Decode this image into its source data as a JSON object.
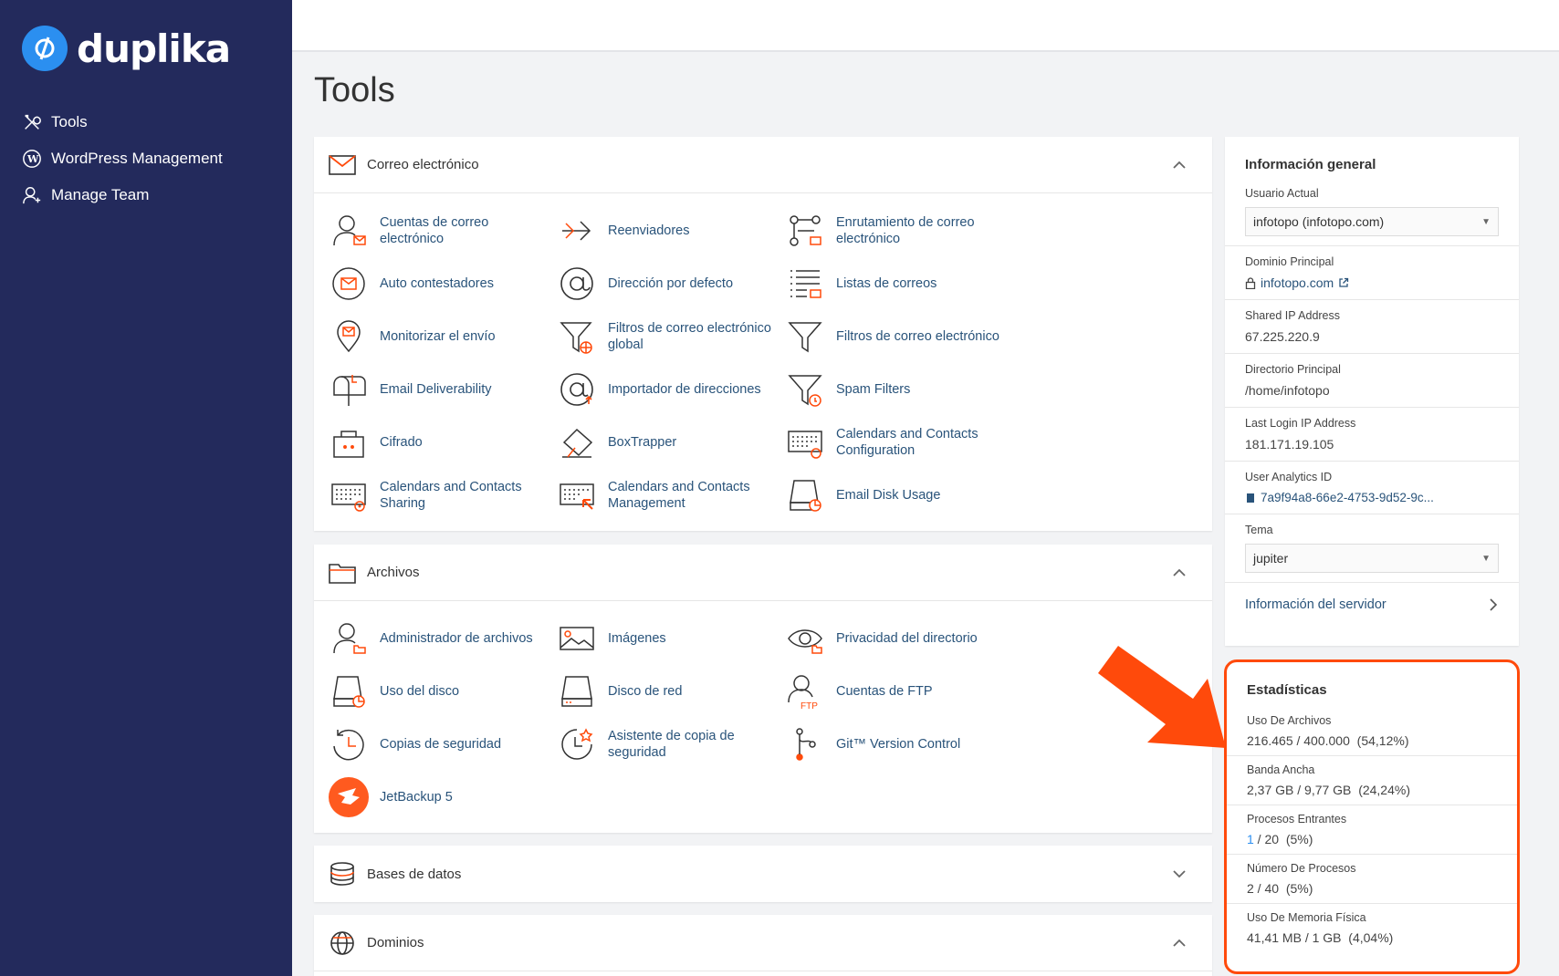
{
  "brand": {
    "name": "duplika"
  },
  "sidebar": {
    "items": [
      {
        "label": "Tools",
        "icon": "tools-icon"
      },
      {
        "label": "WordPress Management",
        "icon": "wordpress-icon"
      },
      {
        "label": "Manage Team",
        "icon": "team-icon"
      }
    ]
  },
  "page": {
    "title": "Tools"
  },
  "sections": {
    "email": {
      "title": "Correo electrónico",
      "tools": [
        [
          "Cuentas de correo",
          "electrónico"
        ],
        [
          "Reenviadores"
        ],
        [
          "Enrutamiento de correo",
          "electrónico"
        ],
        [
          "Auto contestadores"
        ],
        [
          "Dirección por defecto"
        ],
        [
          "Listas de correos"
        ],
        [
          "Monitorizar el envío"
        ],
        [
          "Filtros de correo electrónico",
          "global"
        ],
        [
          "Filtros de correo electrónico"
        ],
        [
          "Email Deliverability"
        ],
        [
          "Importador de direcciones"
        ],
        [
          "Spam Filters"
        ],
        [
          "Cifrado"
        ],
        [
          "BoxTrapper"
        ],
        [
          "Calendars and Contacts",
          "Configuration"
        ],
        [
          "Calendars and Contacts",
          "Sharing"
        ],
        [
          "Calendars and Contacts",
          "Management"
        ],
        [
          "Email Disk Usage"
        ]
      ]
    },
    "files": {
      "title": "Archivos",
      "tools": [
        [
          "Administrador de archivos"
        ],
        [
          "Imágenes"
        ],
        [
          "Privacidad del directorio"
        ],
        [
          "Uso del disco"
        ],
        [
          "Disco de red"
        ],
        [
          "Cuentas de FTP"
        ],
        [
          "Copias de seguridad"
        ],
        [
          "Asistente de copia de",
          "seguridad"
        ],
        [
          "Git™ Version Control"
        ],
        [
          "JetBackup 5"
        ]
      ]
    },
    "databases": {
      "title": "Bases de datos"
    },
    "domains": {
      "title": "Dominios"
    }
  },
  "info": {
    "title": "Información general",
    "current_user_label": "Usuario Actual",
    "current_user_value": "infotopo (infotopo.com)",
    "main_domain_label": "Dominio Principal",
    "main_domain_value": "infotopo.com",
    "shared_ip_label": "Shared IP Address",
    "shared_ip_value": "67.225.220.9",
    "home_dir_label": "Directorio Principal",
    "home_dir_value": "/home/infotopo",
    "last_login_label": "Last Login IP Address",
    "last_login_value": "181.171.19.105",
    "analytics_label": "User Analytics ID",
    "analytics_value": "7a9f94a8-66e2-4753-9d52-9c...",
    "theme_label": "Tema",
    "theme_value": "jupiter",
    "server_info_label": "Información del servidor"
  },
  "stats": {
    "title": "Estadísticas",
    "rows": [
      {
        "label": "Uso De Archivos",
        "value": "216.465 / 400.000",
        "pct": "(54,12%)"
      },
      {
        "label": "Banda Ancha",
        "value": "2,37 GB / 9,77 GB",
        "pct": "(24,24%)"
      },
      {
        "label": "Procesos Entrantes",
        "value_a": "1",
        "value_b": " / 20",
        "pct": "(5%)"
      },
      {
        "label": "Número De Procesos",
        "value": "2 / 40",
        "pct": "(5%)"
      },
      {
        "label": "Uso De Memoria Física",
        "value": "41,41 MB / 1 GB",
        "pct": "(4,04%)"
      }
    ]
  },
  "colors": {
    "sidebar": "#232a5c",
    "accent": "#ff4a0b",
    "link": "#29537a",
    "brand_blue": "#2b8ff0"
  }
}
